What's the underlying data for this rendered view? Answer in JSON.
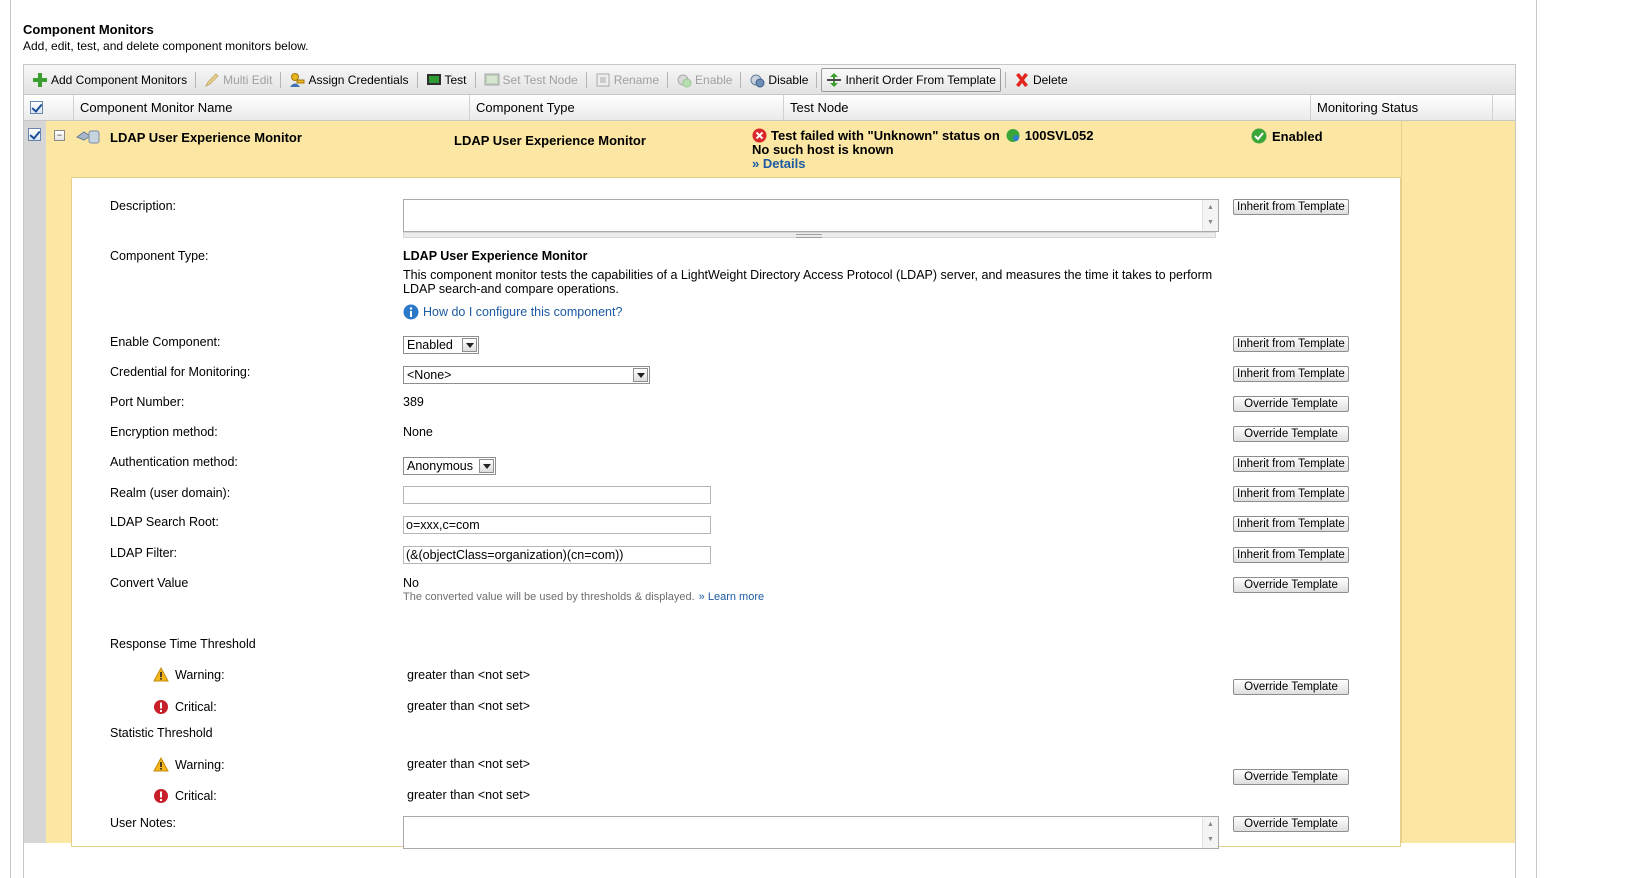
{
  "header": {
    "title": "Component Monitors",
    "subtitle": "Add, edit, test, and delete component monitors below."
  },
  "toolbar": {
    "add": "Add Component Monitors",
    "multi_edit": "Multi Edit",
    "assign_credentials": "Assign Credentials",
    "test": "Test",
    "set_test_node": "Set Test Node",
    "rename": "Rename",
    "enable": "Enable",
    "disable": "Disable",
    "inherit_order": "Inherit Order From Template",
    "delete": "Delete"
  },
  "columns": {
    "name": "Component Monitor Name",
    "type": "Component Type",
    "node": "Test Node",
    "status": "Monitoring Status"
  },
  "row": {
    "name": "LDAP User Experience Monitor",
    "type": "LDAP User Experience Monitor",
    "test_message": "Test failed with \"Unknown\" status on",
    "node_name": "100SVL052",
    "error_message": "No such host is known",
    "details_link": "» Details",
    "status": "Enabled"
  },
  "form": {
    "description_label": "Description:",
    "component_type_label": "Component Type:",
    "component_type_value": "LDAP User Experience Monitor",
    "component_type_desc": "This component monitor tests the capabilities of a LightWeight Directory Access Protocol (LDAP) server, and measures the time it takes to perform LDAP search-and compare operations.",
    "help_link": "How do I configure this component?",
    "enable_label": "Enable Component:",
    "enable_value": "Enabled",
    "credential_label": "Credential for Monitoring:",
    "credential_value": "<None>",
    "port_label": "Port Number:",
    "port_value": "389",
    "encryption_label": "Encryption method:",
    "encryption_value": "None",
    "auth_label": "Authentication method:",
    "auth_value": "Anonymous",
    "realm_label": "Realm (user domain):",
    "realm_value": "",
    "search_root_label": "LDAP Search Root:",
    "search_root_value": "o=xxx,c=com",
    "filter_label": "LDAP Filter:",
    "filter_value": "(&(objectClass=organization)(cn=com))",
    "convert_label": "Convert Value",
    "convert_value": "No",
    "convert_note": "The converted value will be used by thresholds & displayed.",
    "learn_more": "» Learn more",
    "response_threshold_label": "Response Time Threshold",
    "warning_label": "Warning:",
    "critical_label": "Critical:",
    "response_warning_value": "greater than <not set>",
    "response_critical_value": "greater than <not set>",
    "statistic_threshold_label": "Statistic Threshold",
    "statistic_warning_value": "greater than <not set>",
    "statistic_critical_value": "greater than <not set>",
    "user_notes_label": "User Notes:"
  },
  "buttons": {
    "inherit": "Inherit from Template",
    "override": "Override Template"
  },
  "colors": {
    "row_highlight": "#fbe6a4",
    "link": "#1c5aa3",
    "error": "#d9262b",
    "success": "#3aa63a"
  }
}
